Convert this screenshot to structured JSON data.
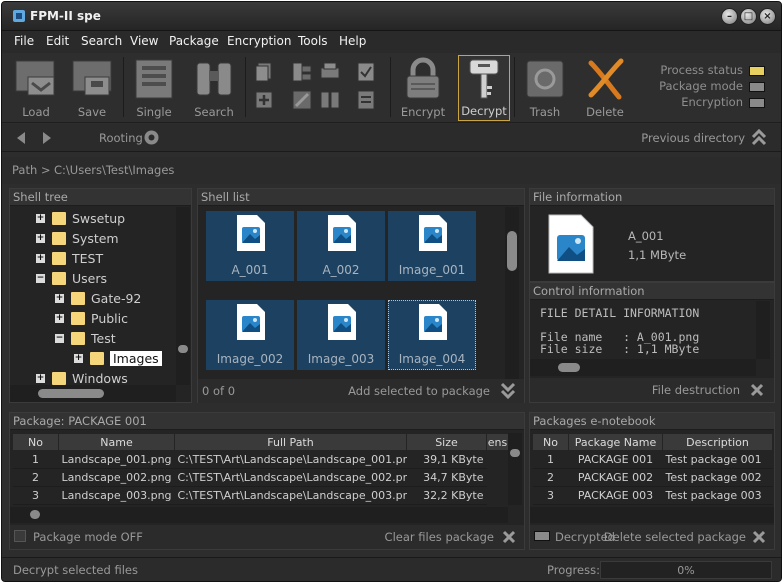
{
  "window": {
    "title": "FPM-II spe"
  },
  "menu": [
    "File",
    "Edit",
    "Search",
    "View",
    "Package",
    "Encryption",
    "Tools",
    "Help"
  ],
  "toolbar": {
    "load": "Load",
    "save": "Save",
    "single": "Single",
    "search": "Search",
    "encrypt": "Encrypt",
    "decrypt": "Decrypt",
    "trash": "Trash",
    "delete": "Delete"
  },
  "status_indicators": {
    "process_status": "Process status",
    "package_mode": "Package mode",
    "encryption": "Encryption",
    "colors": {
      "process_status": "#e8d060",
      "package_mode": "#8a8a8a",
      "encryption": "#8a8a8a"
    }
  },
  "nav": {
    "rooting": "Rooting",
    "previous_directory": "Previous directory"
  },
  "path": {
    "label": "Path >",
    "value": "C:\\Users\\Test\\Images"
  },
  "shell_tree": {
    "title": "Shell tree",
    "items": [
      {
        "label": "Swsetup",
        "expander": "+"
      },
      {
        "label": "System",
        "expander": "+"
      },
      {
        "label": "TEST",
        "expander": "+"
      },
      {
        "label": "Users",
        "expander": "−"
      },
      {
        "label": "Gate-92",
        "expander": "+"
      },
      {
        "label": "Public",
        "expander": "+"
      },
      {
        "label": "Test",
        "expander": "−"
      },
      {
        "label": "Images",
        "expander": "+"
      },
      {
        "label": "Windows",
        "expander": "+"
      }
    ]
  },
  "shell_list": {
    "title": "Shell list",
    "files": [
      "A_001",
      "A_002",
      "Image_001",
      "Image_002",
      "Image_003",
      "Image_004"
    ],
    "count": "0 of 0",
    "add_selected": "Add selected to package"
  },
  "file_info": {
    "title": "File information",
    "name": "A_001",
    "size": "1,1 MByte"
  },
  "control_info": {
    "title": "Control information",
    "line1": "FILE DETAIL INFORMATION",
    "line2": "File name   : A_001.png",
    "line3": "File size   : 1,1 MByte",
    "file_destruction": "File destruction"
  },
  "package": {
    "title": "Package: PACKAGE 001",
    "columns": [
      "No",
      "Name",
      "Full Path",
      "Size",
      "ens"
    ],
    "rows": [
      [
        "1",
        "Landscape_001.png",
        "C:\\TEST\\Art\\Landscape\\Landscape_001.png",
        "39,1 KByte"
      ],
      [
        "2",
        "Landscape_002.png",
        "C:\\TEST\\Art\\Landscape\\Landscape_002.png",
        "34,7 KByte"
      ],
      [
        "3",
        "Landscape_003.png",
        "C:\\TEST\\Art\\Landscape\\Landscape_003.png",
        "32,2 KByte"
      ]
    ],
    "mode_off": "Package mode OFF",
    "clear": "Clear files package"
  },
  "notebook": {
    "title": "Packages e-notebook",
    "columns": [
      "No",
      "Package Name",
      "Description"
    ],
    "rows": [
      [
        "1",
        "PACKAGE 001",
        "Test package 001"
      ],
      [
        "2",
        "PACKAGE 002",
        "Test package 002"
      ],
      [
        "3",
        "PACKAGE 003",
        "Test package 003"
      ]
    ],
    "decrypted": "Decrypted",
    "delete_selected": "Delete selected  package"
  },
  "statusbar": {
    "message": "Decrypt selected files",
    "progress_label": "Progress:",
    "progress_value": "0%",
    "progress": 0
  }
}
